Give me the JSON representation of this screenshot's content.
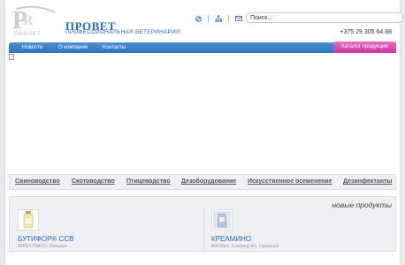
{
  "header": {
    "logo_text": "PROVET",
    "brand_title": "ПРОВЕТ",
    "brand_subtitle": "ПРОФЕССИОНАЛЬНАЯ ВЕТЕРИНАРИЯ",
    "icons": [
      "home-icon",
      "sitemap-icon",
      "mail-icon"
    ],
    "search_placeholder": "Поиск...",
    "phone": "+375 29 305 64 88"
  },
  "nav": {
    "items": [
      {
        "label": "Новости"
      },
      {
        "label": "О компании"
      },
      {
        "label": "Контакты"
      }
    ],
    "catalog_label": "Каталог продукции"
  },
  "categories": [
    {
      "label": "Свиноводство"
    },
    {
      "label": "Скотоводство"
    },
    {
      "label": "Птицеводство"
    },
    {
      "label": "Дезоборудование"
    },
    {
      "label": "Искусственное осеменение"
    },
    {
      "label": "Дезинфектанты"
    }
  ],
  "new_products": {
    "title": "новые продукты",
    "items": [
      {
        "name": "БУТИФОР® ССВ",
        "maker": "IMPEXTRACO, Бельгия"
      },
      {
        "name": "КРЕАМИНО",
        "maker": "AlzChem Trostberg AG, Германия"
      }
    ]
  },
  "colors": {
    "brand_blue": "#2a6bb5",
    "nav_blue": "#3a7fca",
    "catalog_pink": "#d94fae"
  }
}
